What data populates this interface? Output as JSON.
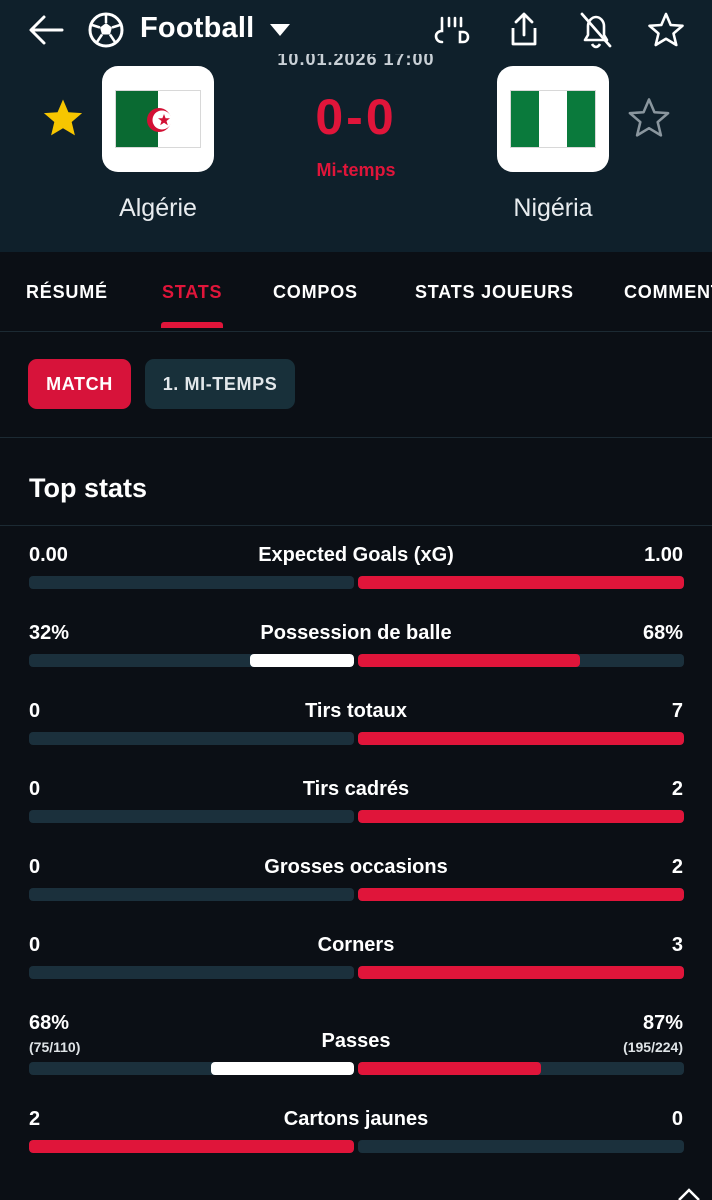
{
  "header": {
    "sport_title": "Football",
    "match_date": "10.01.2026 17:00",
    "score": "0-0",
    "status": "Mi-temps"
  },
  "teams": {
    "home": {
      "name": "Algérie",
      "favorite": true
    },
    "away": {
      "name": "Nigéria",
      "favorite": false
    }
  },
  "tabs": [
    {
      "label": "RÉSUMÉ",
      "active": false
    },
    {
      "label": "STATS",
      "active": true
    },
    {
      "label": "COMPOS",
      "active": false
    },
    {
      "label": "STATS JOUEURS",
      "active": false
    },
    {
      "label": "COMMENTAIRES",
      "active": false
    }
  ],
  "filters": [
    {
      "label": "MATCH",
      "active": true
    },
    {
      "label": "1. MI-TEMPS",
      "active": false
    }
  ],
  "section": {
    "title": "Top stats"
  },
  "colors": {
    "accent": "#e0153a",
    "bar_home_neutral": "#ffffff",
    "track": "#1b303c"
  },
  "stats": [
    {
      "label": "Expected Goals (xG)",
      "home": "0.00",
      "away": "1.00",
      "home_share": 0.0,
      "away_share": 1.0,
      "leader": "away"
    },
    {
      "label": "Possession de balle",
      "home": "32%",
      "away": "68%",
      "home_share": 0.32,
      "away_share": 0.68,
      "leader": "away"
    },
    {
      "label": "Tirs totaux",
      "home": "0",
      "away": "7",
      "home_share": 0.0,
      "away_share": 1.0,
      "leader": "away"
    },
    {
      "label": "Tirs cadrés",
      "home": "0",
      "away": "2",
      "home_share": 0.0,
      "away_share": 1.0,
      "leader": "away"
    },
    {
      "label": "Grosses occasions",
      "home": "0",
      "away": "2",
      "home_share": 0.0,
      "away_share": 1.0,
      "leader": "away"
    },
    {
      "label": "Corners",
      "home": "0",
      "away": "3",
      "home_share": 0.0,
      "away_share": 1.0,
      "leader": "away"
    },
    {
      "label": "Passes",
      "home": "68%",
      "away": "87%",
      "home_sub": "(75/110)",
      "away_sub": "(195/224)",
      "home_share": 0.44,
      "away_share": 0.56,
      "leader": "away"
    },
    {
      "label": "Cartons jaunes",
      "home": "2",
      "away": "0",
      "home_share": 1.0,
      "away_share": 0.0,
      "leader": "home"
    }
  ]
}
